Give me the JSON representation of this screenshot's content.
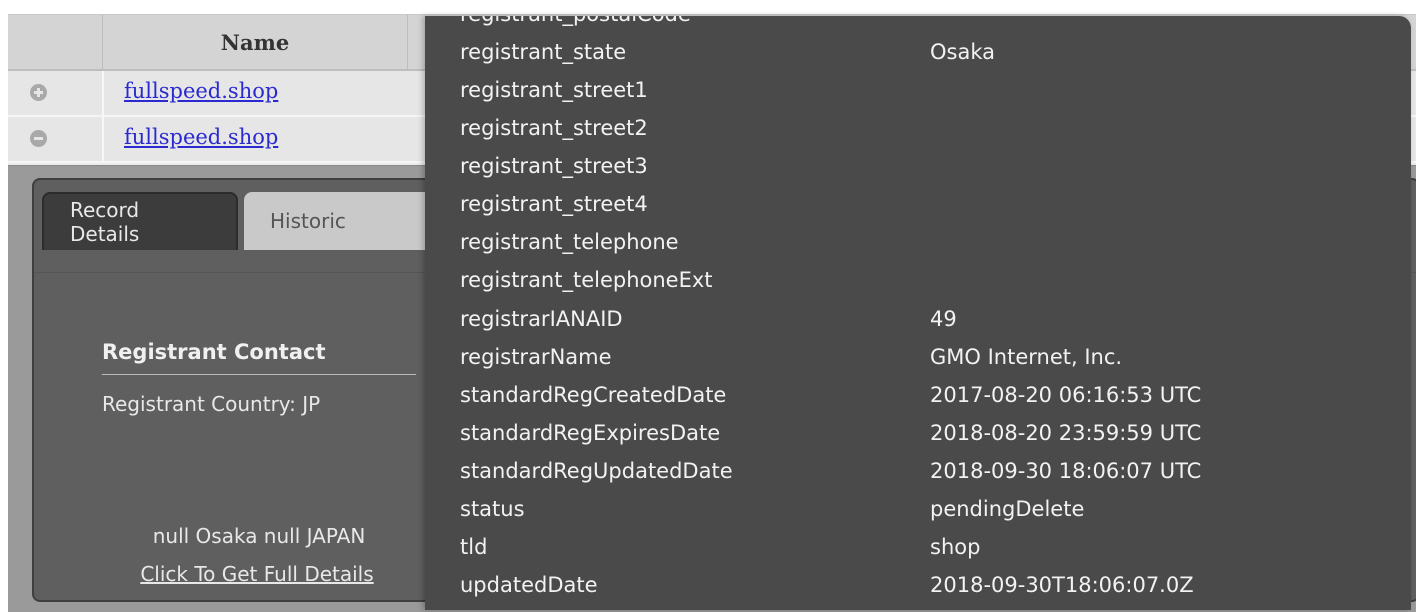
{
  "table": {
    "name_header": "Name",
    "rows": [
      {
        "domain": "fullspeed.shop",
        "toggle": "expand-icon"
      },
      {
        "domain": "fullspeed.shop",
        "toggle": "collapse-icon"
      }
    ]
  },
  "tabs": [
    "Record Details",
    "Historic"
  ],
  "contact": {
    "title": "Registrant Contact",
    "country": "Registrant Country: JP",
    "address": "null Osaka null JAPAN",
    "full_details_link": "Click To Get Full Details"
  },
  "tooltip": {
    "fields": [
      {
        "key": "registrant_postalCode",
        "value": ""
      },
      {
        "key": "registrant_state",
        "value": "Osaka"
      },
      {
        "key": "registrant_street1",
        "value": ""
      },
      {
        "key": "registrant_street2",
        "value": ""
      },
      {
        "key": "registrant_street3",
        "value": ""
      },
      {
        "key": "registrant_street4",
        "value": ""
      },
      {
        "key": "registrant_telephone",
        "value": ""
      },
      {
        "key": "registrant_telephoneExt",
        "value": ""
      },
      {
        "key": "registrarIANAID",
        "value": "49"
      },
      {
        "key": "registrarName",
        "value": "GMO Internet, Inc."
      },
      {
        "key": "standardRegCreatedDate",
        "value": "2017-08-20 06:16:53 UTC"
      },
      {
        "key": "standardRegExpiresDate",
        "value": "2018-08-20 23:59:59 UTC"
      },
      {
        "key": "standardRegUpdatedDate",
        "value": "2018-09-30 18:06:07 UTC"
      },
      {
        "key": "status",
        "value": "pendingDelete"
      },
      {
        "key": "tld",
        "value": "shop"
      },
      {
        "key": "updatedDate",
        "value": "2018-09-30T18:06:07.0Z"
      }
    ]
  },
  "colors": {
    "tooltip_bg": "#4a4a4a",
    "link": "#2a2ad0",
    "detail_bg": "#5f5f5f"
  }
}
